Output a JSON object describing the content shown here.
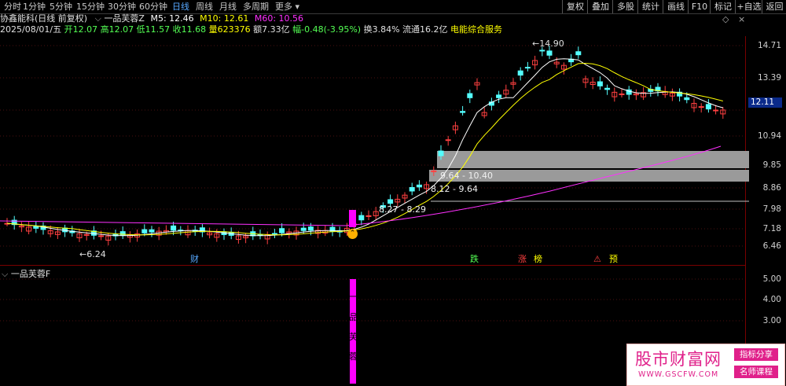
{
  "toolbar": {
    "periods": [
      "分时",
      "1分钟",
      "5分钟",
      "15分钟",
      "30分钟",
      "60分钟",
      "日线",
      "周线",
      "月线",
      "多周期",
      "更多"
    ],
    "active_period": "日线",
    "right_buttons": [
      "复权",
      "叠加",
      "多股",
      "统计",
      "画线",
      "F10",
      "标记",
      "+自选",
      "返回"
    ]
  },
  "header": {
    "stock_name": "协鑫能科",
    "mode": "(日线 前复权)",
    "indicator_name": "一品芙蓉Z",
    "ma5": "M5: 12.46",
    "ma10": "M10: 12.61",
    "ma60": "M60: 10.56",
    "date": "2025/08/01/五",
    "open": "开12.07",
    "high": "高12.07",
    "low": "低11.57",
    "close": "收11.68",
    "volume": "量623376",
    "amount": "额7.33亿",
    "change": "幅-0.48(-3.95%)",
    "turnover": "换3.84%",
    "float_cap": "流通16.2亿",
    "sector": "电能综合服务"
  },
  "price_axis": [
    "14.71",
    "13.39",
    "12.11",
    "10.94",
    "9.85",
    "8.86",
    "7.98",
    "7.18",
    "6.46"
  ],
  "current_price_tag": "12.11",
  "annotations": {
    "high_label": "14.90",
    "low_label": "6.24",
    "gap1": "9.64 - 10.40",
    "gap2": "8.12 - 9.64",
    "gap3": "8.27 - 8.29"
  },
  "markers": {
    "cai": "财",
    "die": "跌",
    "zhang": "涨",
    "bang": "榜",
    "wu": "⚠",
    "yu": "预"
  },
  "sub_panel": {
    "title": "一品芙蓉F",
    "axis": [
      "5.00",
      "4.00",
      "3.00"
    ],
    "signal_text": [
      "一",
      "品",
      "芙",
      "蓉"
    ]
  },
  "watermark": {
    "title": "股市财富网",
    "url": "WWW.GSCFW.COM",
    "tag1": "指标分享",
    "tag2": "名师课程"
  },
  "colors": {
    "up": "#ff4040",
    "down": "#54ffff",
    "ma5": "#ffffff",
    "ma10": "#ffff00",
    "ma60": "#ff30ff",
    "accent": "#57a8ff",
    "signal": "#ff00ff"
  },
  "chart_data": {
    "type": "candlestick",
    "series": [
      {
        "name": "M5",
        "value": 12.46
      },
      {
        "name": "M10",
        "value": 12.61
      },
      {
        "name": "M60",
        "value": 10.56
      }
    ],
    "price_axis_ticks": [
      14.71,
      13.39,
      12.11,
      10.94,
      9.85,
      8.86,
      7.98,
      7.18,
      6.46
    ],
    "high": 14.9,
    "low": 6.24,
    "last": {
      "open": 12.07,
      "high": 12.07,
      "low": 11.57,
      "close": 11.68
    }
  }
}
